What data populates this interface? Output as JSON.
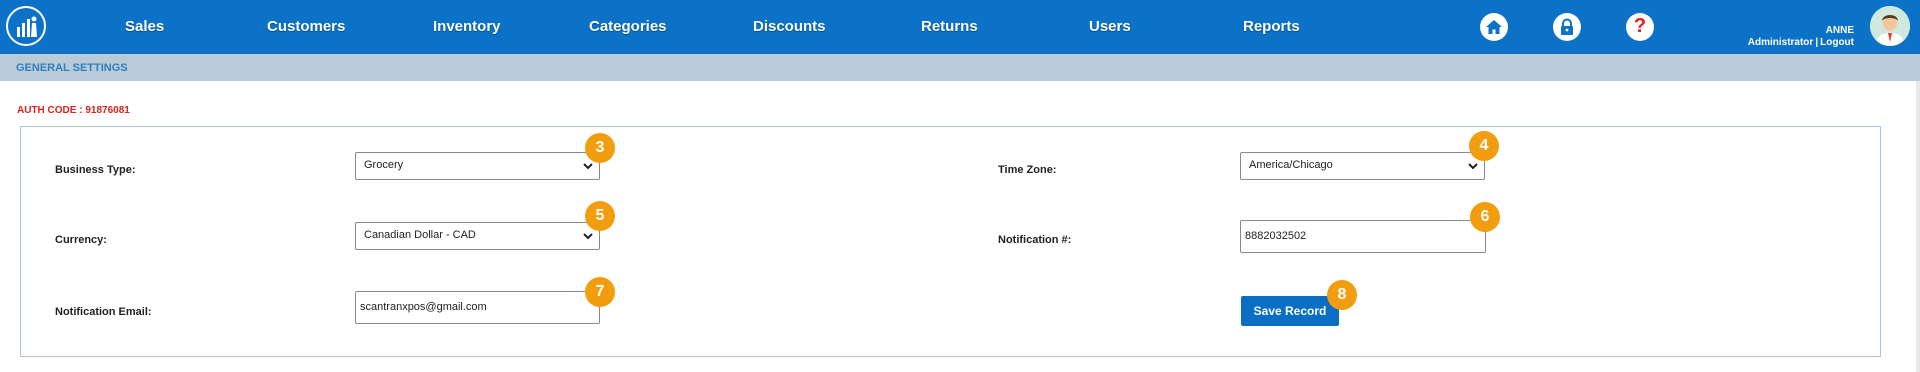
{
  "nav": {
    "items": [
      {
        "label": "Sales"
      },
      {
        "label": "Customers"
      },
      {
        "label": "Inventory"
      },
      {
        "label": "Categories"
      },
      {
        "label": "Discounts"
      },
      {
        "label": "Returns"
      },
      {
        "label": "Users"
      },
      {
        "label": "Reports"
      }
    ],
    "icons": {
      "home": "home-icon",
      "lock": "lock-icon",
      "help": "help-icon",
      "help_glyph": "?"
    }
  },
  "user": {
    "name": "ANNE",
    "role": "Administrator",
    "separator": "|",
    "logout": "Logout"
  },
  "subheader": {
    "title": "GENERAL SETTINGS"
  },
  "auth": {
    "text": "AUTH CODE : 91876081"
  },
  "form": {
    "business_type": {
      "label": "Business Type:",
      "value": "Grocery"
    },
    "currency": {
      "label": "Currency:",
      "value": "Canadian Dollar - CAD"
    },
    "notification_email": {
      "label": "Notification Email:",
      "value": "scantranxpos@gmail.com"
    },
    "time_zone": {
      "label": "Time Zone:",
      "value": "America/Chicago"
    },
    "notification_number": {
      "label": "Notification #:",
      "value": "8882032502"
    },
    "save_label": "Save Record"
  },
  "badges": [
    "3",
    "4",
    "5",
    "6",
    "7",
    "8"
  ],
  "colors": {
    "nav_bg": "#0b72c8",
    "subheader_bg": "#b9cbd9",
    "auth_red": "#e0201a",
    "badge_orange": "#f29d0f",
    "button_blue": "#0a6fc4"
  }
}
